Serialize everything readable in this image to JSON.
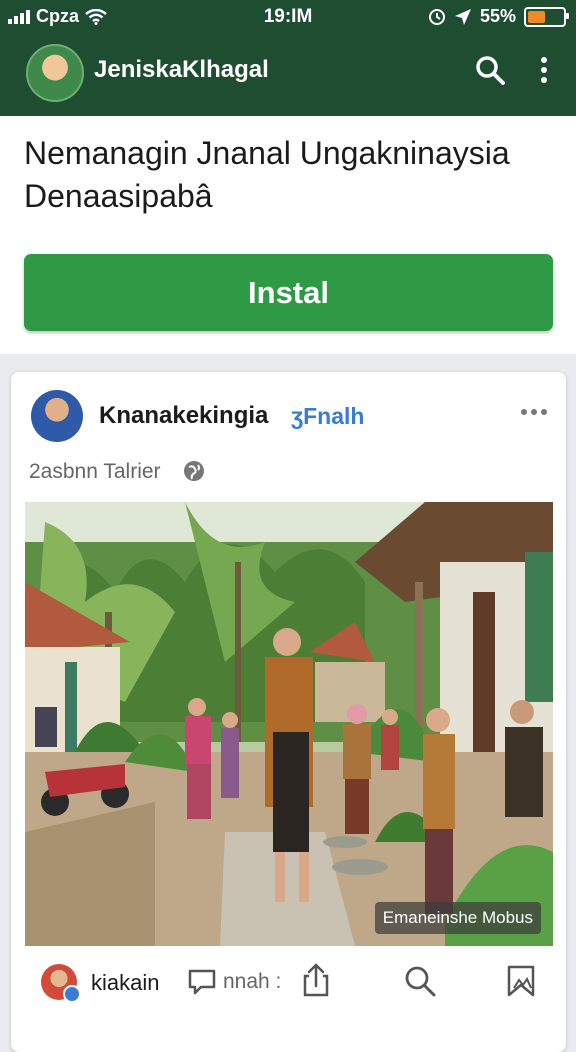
{
  "status_bar": {
    "carrier": "Cpza",
    "time": "19:IM",
    "battery": "55%",
    "battery_level": 0.55
  },
  "app_bar": {
    "title": "JeniskaKlhagal",
    "icons": [
      "search-icon",
      "more-vert-icon"
    ]
  },
  "install_banner": {
    "heading": "Nemanagin Jnanal Ungakninaysia Denaasipabâ",
    "button_label": "Instal",
    "button_color": "#2f9a45"
  },
  "post": {
    "author": "Knanakekingia",
    "badge": "ʒFnalh",
    "timestamp": "2asbnn Talrier",
    "photo_caption": "Emaneinshe Mobus",
    "actions": {
      "name": "kiakain",
      "comment_label": "nnah :",
      "icons": [
        "comment-icon",
        "share-icon",
        "search-icon",
        "bookmark-icon"
      ]
    }
  },
  "colors": {
    "header": "#1f4d32",
    "accent_blue": "#3a7bd5",
    "background": "#e9ebee"
  }
}
